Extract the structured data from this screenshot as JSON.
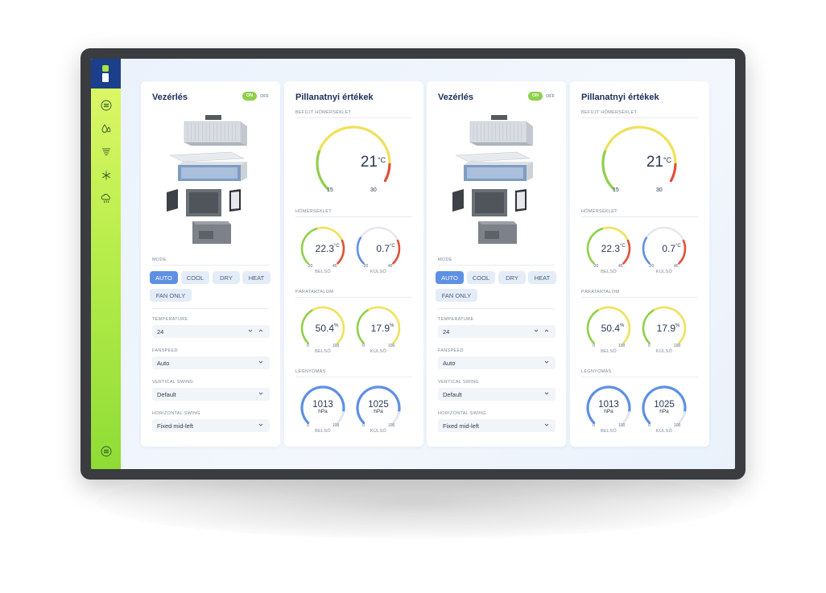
{
  "sidebar": {
    "icons": [
      "menu-circle-icon",
      "droplets-icon",
      "tornado-icon",
      "snowflake-icon",
      "cloud-rain-icon"
    ],
    "bottom_icon": "menu-circle-icon"
  },
  "colors": {
    "accent": "#5e90e4",
    "title": "#1c2e5a",
    "toggle_on": "#8fd04a",
    "gauge_green": "#8fd04a",
    "gauge_yellow": "#f0e15a",
    "gauge_red": "#e0503a",
    "gauge_blue": "#5e90e4",
    "sidebar_top": "#e2f86a",
    "sidebar_bottom": "#8fdc35"
  },
  "control_panels": [
    {
      "title": "Vezérlés",
      "toggle": {
        "on": "ON",
        "off": "OFF"
      },
      "mode_label": "MODE",
      "modes": [
        "AUTO",
        "COOL",
        "DRY",
        "HEAT",
        "FAN ONLY"
      ],
      "active_mode": "AUTO",
      "temperature_label": "TEMPERATURE",
      "temperature_value": "24",
      "fanspeed_label": "FANSPEED",
      "fanspeed_value": "Auto",
      "vswing_label": "VERTICAL SWING",
      "vswing_value": "Default",
      "hswing_label": "HORIZONTAL SWING",
      "hswing_value": "Fixed mid-left"
    },
    {
      "title": "Vezérlés",
      "toggle": {
        "on": "ON",
        "off": "OFF"
      },
      "mode_label": "MODE",
      "modes": [
        "AUTO",
        "COOL",
        "DRY",
        "HEAT",
        "FAN ONLY"
      ],
      "active_mode": "AUTO",
      "temperature_label": "TEMPERATURE",
      "temperature_value": "24",
      "fanspeed_label": "FANSPEED",
      "fanspeed_value": "Auto",
      "vswing_label": "VERTICAL SWING",
      "vswing_value": "Default",
      "hswing_label": "HORIZONTAL SWING",
      "hswing_value": "Fixed mid-left"
    }
  ],
  "readings_panels": [
    {
      "title": "Pillanatnyi értékek",
      "supply": {
        "label": "BEFÚJT HŐMÉRSÉKLET",
        "value": "21",
        "unit": "°C",
        "min": "15",
        "max": "30"
      },
      "temperature": {
        "label": "HŐMÉRSÉKLET",
        "inner": {
          "value": "22.3",
          "unit": "°C",
          "min": "-20",
          "max": "45",
          "label": "BELSŐ"
        },
        "outer": {
          "value": "0.7",
          "unit": "°C",
          "min": "-20",
          "max": "45",
          "label": "KÜLSŐ"
        }
      },
      "humidity": {
        "label": "PÁRATARTALOM",
        "inner": {
          "value": "50.4",
          "unit": "%",
          "min": "0",
          "max": "100",
          "label": "BELSŐ"
        },
        "outer": {
          "value": "17.9",
          "unit": "%",
          "min": "0",
          "max": "100",
          "label": "KÜLSŐ"
        }
      },
      "pressure": {
        "label": "LÉGNYOMÁS",
        "inner": {
          "value": "1013",
          "unit": "hPa",
          "min": "0",
          "max": "100",
          "label": "BELSŐ"
        },
        "outer": {
          "value": "1025",
          "unit": "hPa",
          "min": "0",
          "max": "100",
          "label": "KÜLSŐ"
        }
      }
    },
    {
      "title": "Pillanatnyi értékek",
      "supply": {
        "label": "BEFÚJT HŐMÉRSÉKLET",
        "value": "21",
        "unit": "°C",
        "min": "15",
        "max": "30"
      },
      "temperature": {
        "label": "HŐMÉRSÉKLET",
        "inner": {
          "value": "22.3",
          "unit": "°C",
          "min": "-20",
          "max": "45",
          "label": "BELSŐ"
        },
        "outer": {
          "value": "0.7",
          "unit": "°C",
          "min": "-20",
          "max": "45",
          "label": "KÜLSŐ"
        }
      },
      "humidity": {
        "label": "PÁRATARTALOM",
        "inner": {
          "value": "50.4",
          "unit": "%",
          "min": "0",
          "max": "100",
          "label": "BELSŐ"
        },
        "outer": {
          "value": "17.9",
          "unit": "%",
          "min": "0",
          "max": "100",
          "label": "KÜLSŐ"
        }
      },
      "pressure": {
        "label": "LÉGNYOMÁS",
        "inner": {
          "value": "1013",
          "unit": "hPa",
          "min": "0",
          "max": "100",
          "label": "BELSŐ"
        },
        "outer": {
          "value": "1025",
          "unit": "hPa",
          "min": "0",
          "max": "100",
          "label": "KÜLSŐ"
        }
      }
    }
  ]
}
